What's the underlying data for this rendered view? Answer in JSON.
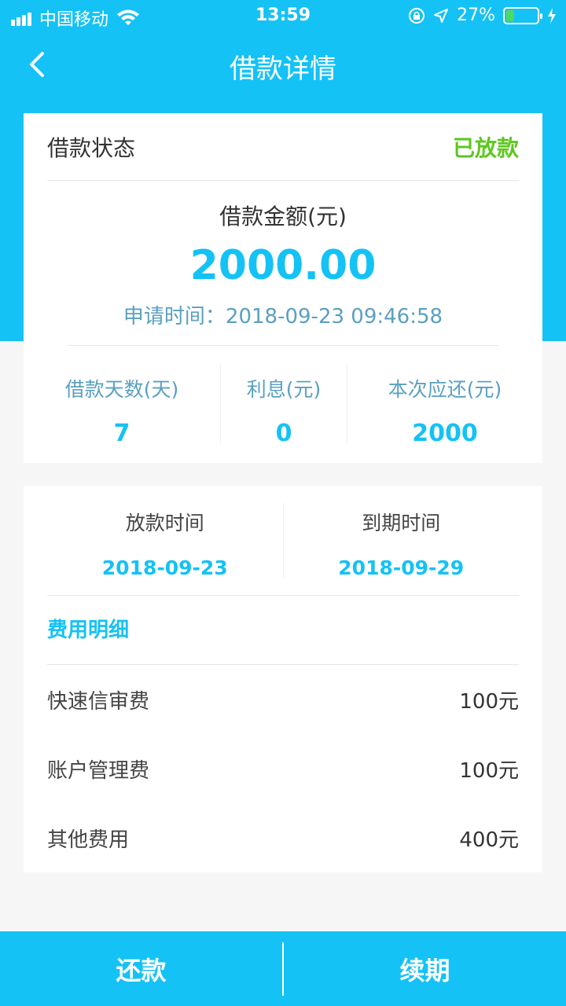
{
  "status_bar": {
    "carrier": "中国移动",
    "time": "13:59",
    "battery": "27%",
    "battery_level": 0.27
  },
  "nav": {
    "title": "借款详情"
  },
  "loan": {
    "status_label": "借款状态",
    "status_value": "已放款",
    "amount_label": "借款金额(元)",
    "amount_value": "2000.00",
    "apply_time": "申请时间：2018-09-23 09:46:58",
    "stats": [
      {
        "label": "借款天数(天)",
        "value": "7"
      },
      {
        "label": "利息(元)",
        "value": "0"
      },
      {
        "label": "本次应还(元)",
        "value": "2000"
      }
    ]
  },
  "dates": {
    "disburse_label": "放款时间",
    "disburse_value": "2018-09-23",
    "due_label": "到期时间",
    "due_value": "2018-09-29"
  },
  "fees": {
    "title": "费用明细",
    "items": [
      {
        "name": "快速信审费",
        "amount": "100元"
      },
      {
        "name": "账户管理费",
        "amount": "100元"
      },
      {
        "name": "其他费用",
        "amount": "400元"
      }
    ]
  },
  "bottom": {
    "repay_label": "还款",
    "renew_label": "续期"
  },
  "colors": {
    "primary": "#14c2f5",
    "status_green": "#5cc81f"
  }
}
